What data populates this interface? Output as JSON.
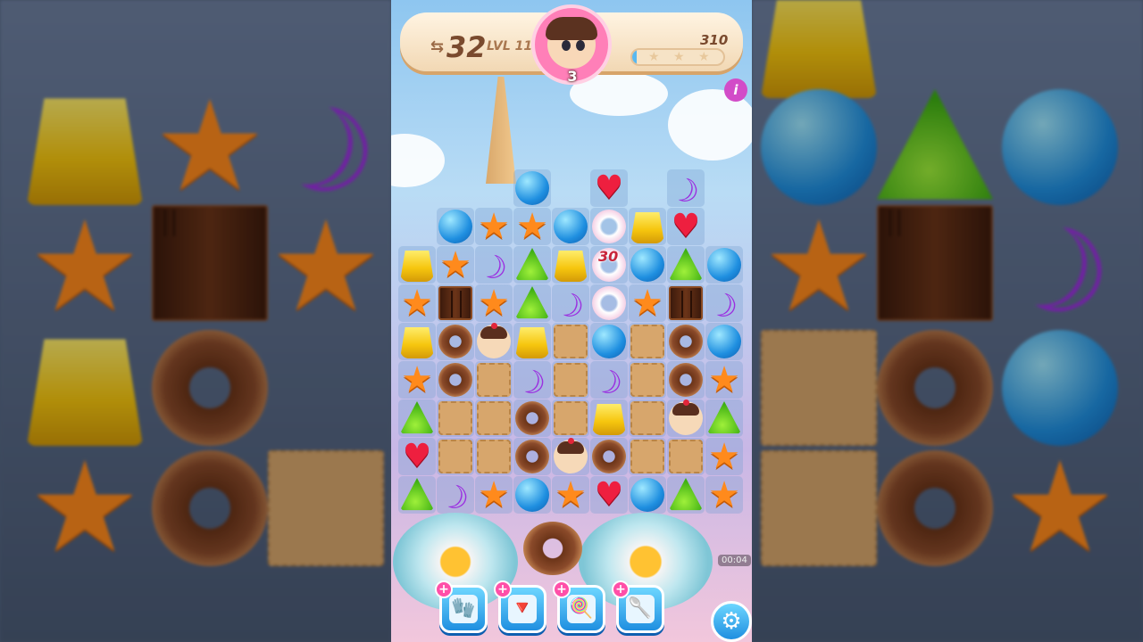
{
  "hud": {
    "moves": "32",
    "level": "LVL 115",
    "score": "310",
    "avatar_count": "3",
    "info": "i",
    "progress_fraction": 0.05
  },
  "board": {
    "score_popup": "30",
    "rows": [
      [
        "",
        "",
        "",
        "blue",
        "",
        "heart",
        "",
        "moon",
        "",
        ""
      ],
      [
        "",
        "blue",
        "star",
        "star",
        "blue",
        "ring",
        "yellow",
        "heart",
        "",
        ""
      ],
      [
        "yellow",
        "star",
        "moon",
        "green",
        "yellow",
        "ring",
        "blue",
        "green",
        "blue",
        ""
      ],
      [
        "star",
        "choco",
        "star",
        "green",
        "moon",
        "ring",
        "star",
        "choco",
        "moon",
        ""
      ],
      [
        "yellow",
        "donut",
        "char",
        "yellow",
        "biscuit",
        "blue",
        "biscuit",
        "donut",
        "blue",
        ""
      ],
      [
        "star",
        "donut",
        "biscuit",
        "moon",
        "biscuit",
        "moon",
        "biscuit",
        "donut",
        "star",
        ""
      ],
      [
        "green",
        "biscuit",
        "biscuit",
        "donut",
        "biscuit",
        "yellow",
        "biscuit",
        "char",
        "green",
        ""
      ],
      [
        "heart",
        "biscuit",
        "biscuit",
        "donut",
        "char",
        "donut",
        "biscuit",
        "biscuit",
        "star",
        ""
      ],
      [
        "green",
        "moon",
        "star",
        "blue",
        "star",
        "heart",
        "blue",
        "green",
        "star",
        ""
      ]
    ]
  },
  "timer": "00:04",
  "boosters": [
    {
      "name": "oven-mitt",
      "icon": "mitt-icon",
      "plus": "+"
    },
    {
      "name": "piping-bag",
      "icon": "piping-bag-icon",
      "plus": "+"
    },
    {
      "name": "candy-stick",
      "icon": "candy-stick-icon",
      "plus": "+"
    },
    {
      "name": "spoon",
      "icon": "spoon-icon",
      "plus": "+"
    }
  ],
  "settings_icon": "gear-icon",
  "colors": {
    "blue": "#1f8fe0",
    "yellow": "#f6c60e",
    "green": "#3cae12",
    "orange": "#ff8a1c",
    "purple": "#9b2fe0",
    "red": "#ee1f3f",
    "pink": "#ff7fb8"
  }
}
